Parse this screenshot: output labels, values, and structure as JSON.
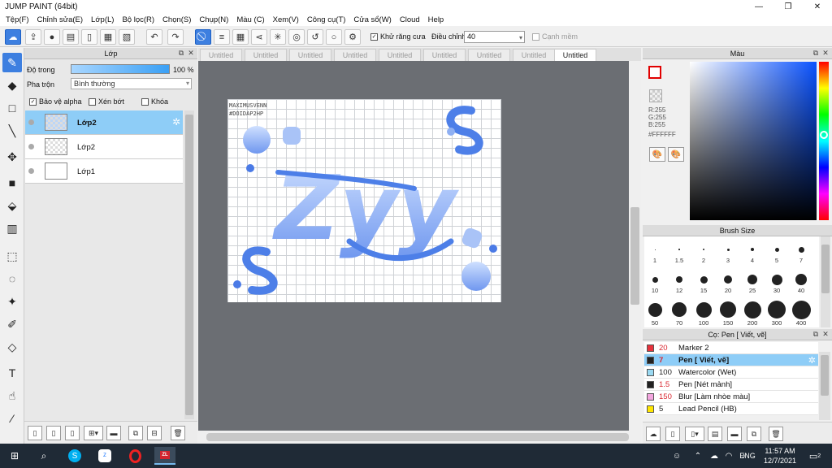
{
  "window": {
    "title": "JUMP PAINT (64bit)",
    "min": "—",
    "max": "❐",
    "close": "✕"
  },
  "menu": [
    "Tệp(F)",
    "Chỉnh sửa(E)",
    "Lớp(L)",
    "Bộ lọc(R)",
    "Chọn(S)",
    "Chụp(N)",
    "Màu (C)",
    "Xem(V)",
    "Công cụ(T)",
    "Cửa sổ(W)",
    "Cloud",
    "Help"
  ],
  "toolbar": {
    "antialias_label": "Khử răng cưa",
    "adjust_label": "Điều chỉnh",
    "adjust_value": "40",
    "smooth_label": "Cạnh mềm"
  },
  "layers_panel": {
    "title": "Lớp",
    "opacity_label": "Độ trong",
    "opacity_value": "100 %",
    "opacity_fraction": 1.0,
    "blend_label": "Pha trộn",
    "blend_value": "Bình thường",
    "protect_alpha": "Bảo vệ alpha",
    "clip": "Xén bớt",
    "lock": "Khóa",
    "layers": [
      {
        "name": "Lớp2",
        "active": true
      },
      {
        "name": "Lớp2",
        "active": false
      },
      {
        "name": "Lớp1",
        "active": false
      }
    ]
  },
  "tabs": [
    "Untitled",
    "Untitled",
    "Untitled",
    "Untitled",
    "Untitled",
    "Untitled",
    "Untitled",
    "Untitled",
    "Untitled"
  ],
  "artwork": {
    "watermark_line1": "MAXIMUSVENN",
    "watermark_line2": "#DOIDAP2HP",
    "text": "Zyy"
  },
  "color_panel": {
    "title": "Màu",
    "r": "R:255",
    "g": "G:255",
    "b": "B:255",
    "hex": "#FFFFFF"
  },
  "brush_size_panel": {
    "title": "Brush Size",
    "sizes": [
      "1",
      "1.5",
      "2",
      "3",
      "4",
      "5",
      "7",
      "10",
      "12",
      "15",
      "20",
      "25",
      "30",
      "40",
      "50",
      "70",
      "100",
      "150",
      "200",
      "300",
      "400"
    ]
  },
  "tool_panel": {
    "title": "Cọ: Pen [ Viết, vẽ]",
    "items": [
      {
        "size": "20",
        "name": "Marker 2",
        "color": "#e8323c",
        "active": false
      },
      {
        "size": "7",
        "name": "Pen [ Viết, vẽ]",
        "color": "#222222",
        "active": true
      },
      {
        "size": "100",
        "name": "Watercolor (Wet)",
        "color": "#9ad9f2",
        "active": false
      },
      {
        "size": "1.5",
        "name": "Pen [Nét mảnh]",
        "color": "#222222",
        "active": false
      },
      {
        "size": "150",
        "name": "Blur [Làm nhòe màu]",
        "color": "#f3a6df",
        "active": false
      },
      {
        "size": "5",
        "name": "Lead Pencil (HB)",
        "color": "#ffe600",
        "active": false
      }
    ]
  },
  "taskbar": {
    "time": "11:57 AM",
    "date": "12/7/2021",
    "lang": "ENG",
    "notif": "2",
    "app_label": "ZL"
  }
}
